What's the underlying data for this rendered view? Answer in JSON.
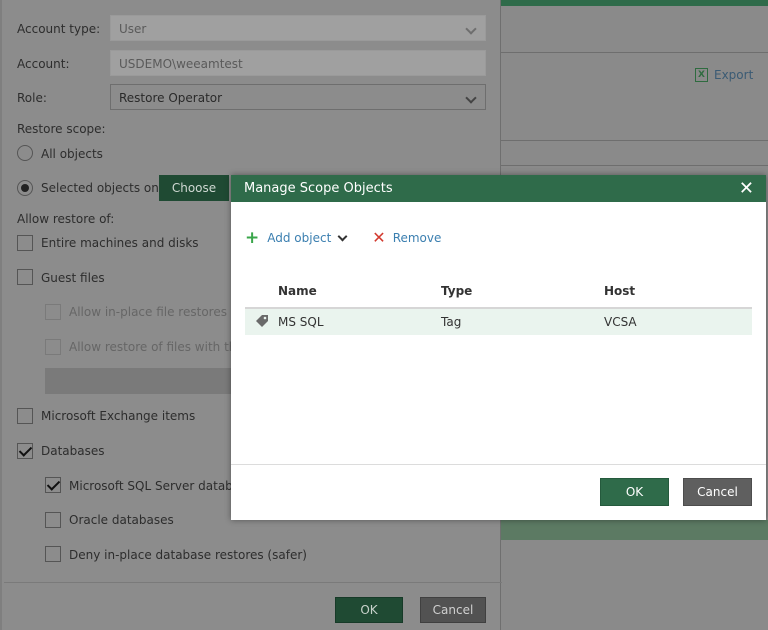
{
  "background": {
    "export_label": "Export",
    "export_icon": "excel-icon",
    "accent": "#2f6b4a"
  },
  "role_dialog": {
    "account_type_label": "Account type:",
    "account_type_value": "User",
    "account_label": "Account:",
    "account_value": "USDEMO\\weeamtest",
    "role_label": "Role:",
    "role_value": "Restore Operator",
    "restore_scope_label": "Restore scope:",
    "all_objects_label": "All objects",
    "selected_objects_label": "Selected objects only",
    "choose_label": "Choose",
    "allow_restore_label": "Allow restore of:",
    "options": {
      "entire_machines": "Entire machines and disks",
      "guest_files": "Guest files",
      "inplace_only": "Allow in-place file restores only",
      "restore_files_with": "Allow restore of files with these",
      "exchange": "Microsoft Exchange items",
      "databases": "Databases",
      "sql_server": "Microsoft SQL Server databases",
      "oracle": "Oracle databases",
      "deny_inplace": "Deny in-place database restores (safer)"
    },
    "ok_label": "OK",
    "cancel_label": "Cancel"
  },
  "modal": {
    "title": "Manage Scope Objects",
    "close_icon": "close-icon",
    "toolbar": {
      "add_label": "Add object",
      "remove_label": "Remove"
    },
    "columns": [
      "Name",
      "Type",
      "Host"
    ],
    "rows": [
      {
        "icon": "tag-icon",
        "name": "MS SQL",
        "type": "Tag",
        "host": "VCSA"
      }
    ],
    "ok_label": "OK",
    "cancel_label": "Cancel",
    "selected_row_color": "#eaf4ee"
  }
}
